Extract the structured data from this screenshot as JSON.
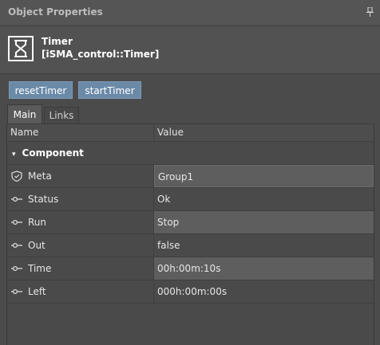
{
  "panel": {
    "title": "Object Properties"
  },
  "object": {
    "name": "Timer",
    "type": "[iSMA_control::Timer]"
  },
  "actions": {
    "reset": "resetTimer",
    "start": "startTimer"
  },
  "tabs": {
    "main": "Main",
    "links": "Links"
  },
  "grid": {
    "col_name": "Name",
    "col_value": "Value",
    "section": "Component",
    "rows": [
      {
        "name": "Meta",
        "value": "Group1",
        "icon": "shield-icon"
      },
      {
        "name": "Status",
        "value": "Ok",
        "icon": "slot-icon"
      },
      {
        "name": "Run",
        "value": "Stop",
        "icon": "slot-icon"
      },
      {
        "name": "Out",
        "value": "false",
        "icon": "slot-icon"
      },
      {
        "name": "Time",
        "value": "00h:00m:10s",
        "icon": "slot-icon"
      },
      {
        "name": "Left",
        "value": "000h:00m:00s",
        "icon": "slot-icon"
      }
    ]
  },
  "colors": {
    "accent": "#6b8aa8",
    "background": "#4b4b4b"
  }
}
